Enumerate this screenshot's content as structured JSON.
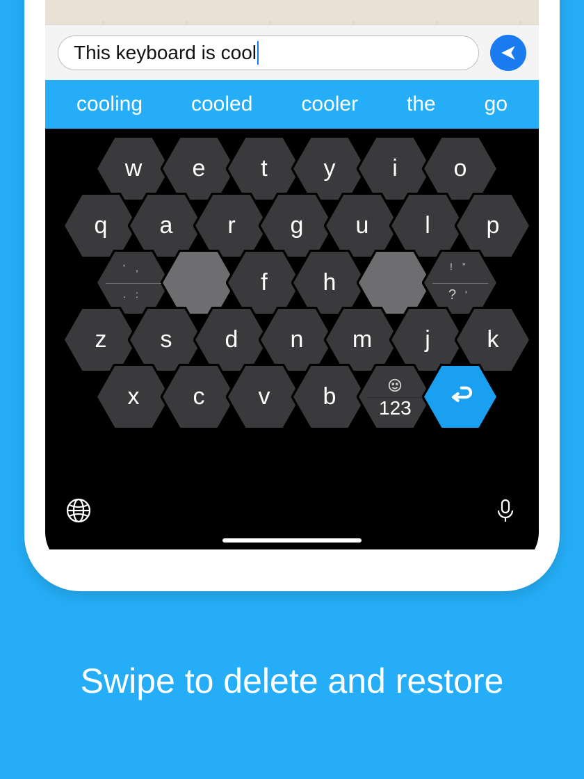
{
  "compose": {
    "text": "This keyboard is cool"
  },
  "suggestions": [
    "cooling",
    "cooled",
    "cooler",
    "the",
    "go"
  ],
  "keys": {
    "row1": [
      "w",
      "e",
      "t",
      "y",
      "i",
      "o"
    ],
    "row2": [
      "q",
      "a",
      "r",
      "g",
      "u",
      "l",
      "p"
    ],
    "row3_mid": [
      "f",
      "h"
    ],
    "row4": [
      "z",
      "s",
      "d",
      "n",
      "m",
      "j",
      "k"
    ],
    "row5": [
      "x",
      "c",
      "v",
      "b"
    ]
  },
  "punct_left": {
    "top": "' ,",
    "bot": ". :"
  },
  "punct_right": {
    "top": "! \"",
    "bot": "? '"
  },
  "numkey": "123",
  "headline": "Swipe to delete and restore"
}
